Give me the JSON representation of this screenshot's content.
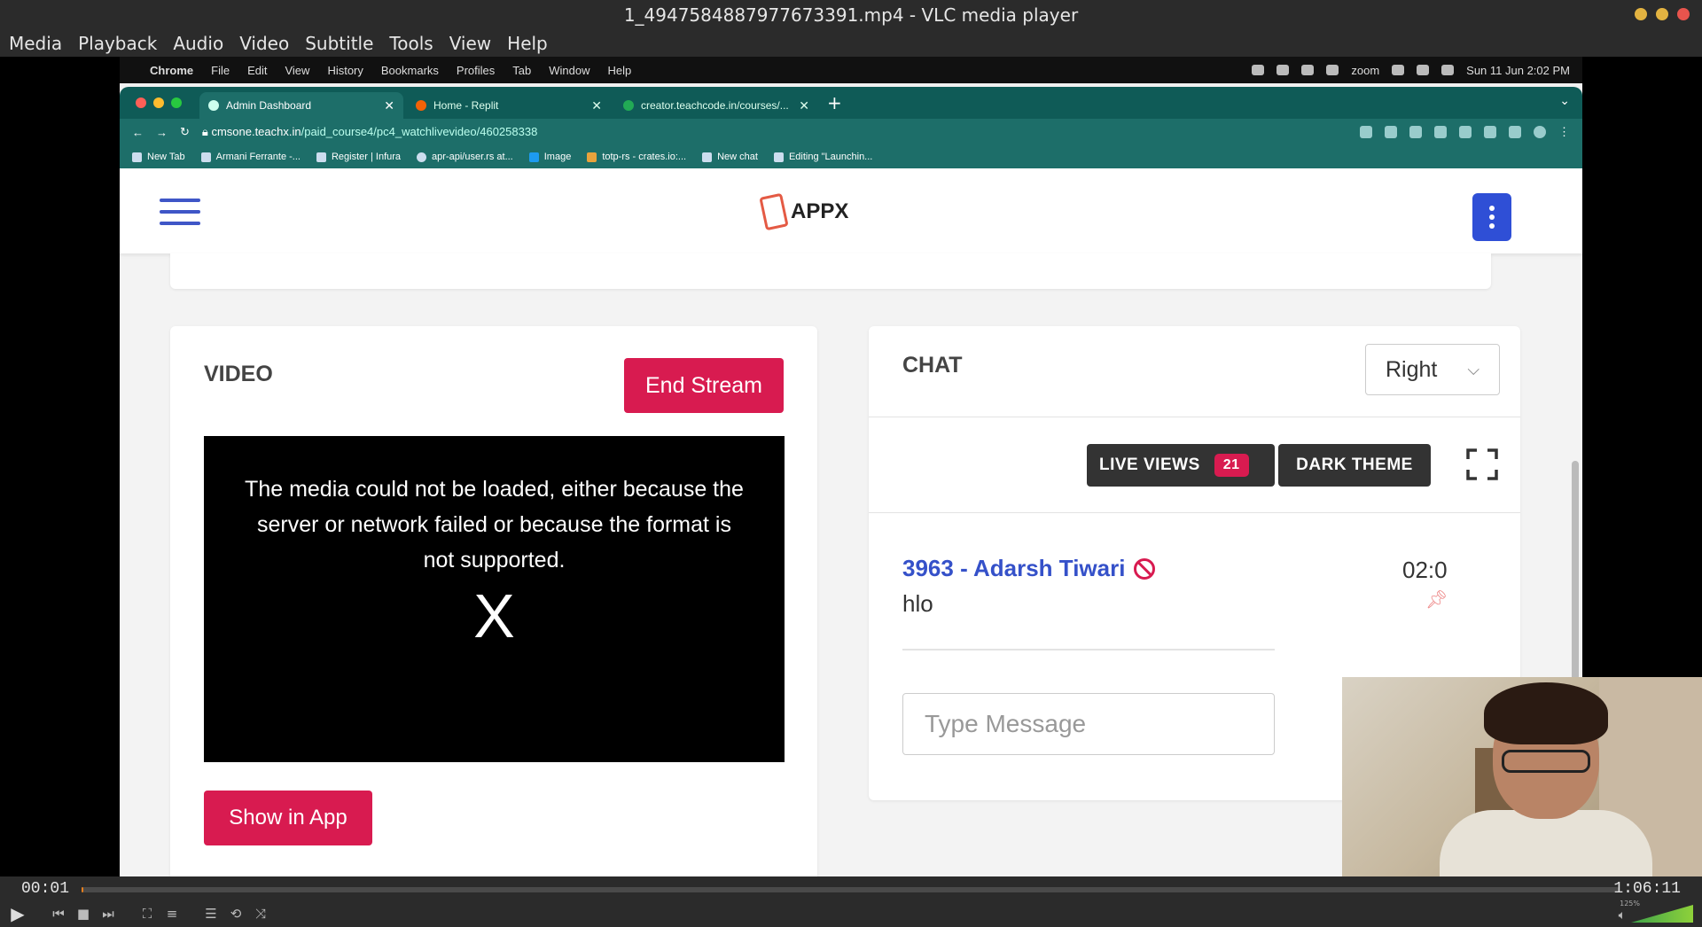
{
  "vlc": {
    "window_title": "1_4947584887977673391.mp4 - VLC media player",
    "menu": [
      "Media",
      "Playback",
      "Audio",
      "Video",
      "Subtitle",
      "Tools",
      "View",
      "Help"
    ],
    "time_current": "00:01",
    "time_total": "1:06:11",
    "progress_fraction": 0.0003,
    "volume_label": "125%"
  },
  "mac_menubar": {
    "items": [
      "Chrome",
      "File",
      "Edit",
      "View",
      "History",
      "Bookmarks",
      "Profiles",
      "Tab",
      "Window",
      "Help"
    ],
    "zoom": "zoom",
    "clock": "Sun 11 Jun  2:02 PM"
  },
  "chrome": {
    "tabs": [
      {
        "label": "Admin Dashboard"
      },
      {
        "label": "Home - Replit"
      },
      {
        "label": "creator.teachcode.in/courses/..."
      }
    ],
    "url_host": "cmsone.teachx.in",
    "url_path": "/paid_course4/pc4_watchlivevideo/460258338",
    "bookmarks": [
      "New Tab",
      "Armani Ferrante -...",
      "Register | Infura",
      "apr-api/user.rs at...",
      "Image",
      "totp-rs - crates.io:...",
      "New chat",
      "Editing \"Launchin..."
    ]
  },
  "page": {
    "logo_text": "APPX",
    "video_card": {
      "title": "VIDEO",
      "end_stream": "End Stream",
      "error_text": "The media could not be loaded, either because the server or network failed or because the format is not supported.",
      "error_x": "X",
      "show_in_app": "Show in App"
    },
    "chat_card": {
      "title": "CHAT",
      "position_select": "Right",
      "live_views_label": "LIVE VIEWS",
      "live_views_count": "21",
      "dark_theme": "DARK THEME",
      "message": {
        "user": "3963 - Adarsh Tiwari",
        "time": "02:0",
        "text": "hlo"
      },
      "input_placeholder": "Type Message"
    }
  }
}
